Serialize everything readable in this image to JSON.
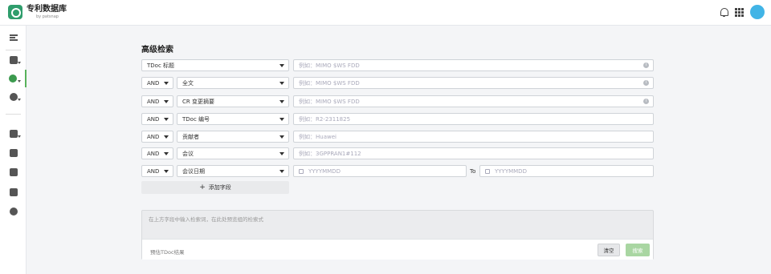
{
  "header": {
    "app_title": "专利数据库",
    "app_subtitle": "by patsnap"
  },
  "page": {
    "title": "高级检索"
  },
  "operator_label": "AND",
  "rows": [
    {
      "field": "TDoc 标题",
      "placeholder": "例如：MIMO $WS FDD",
      "info": "i"
    },
    {
      "field": "全文",
      "placeholder": "例如：MIMO $WS FDD",
      "info": "i"
    },
    {
      "field": "CR 变更摘要",
      "placeholder": "例如：MIMO $WS FDD",
      "info": "i"
    },
    {
      "field": "TDoc 编号",
      "placeholder": "例如：R2-2311825"
    },
    {
      "field": "贡献者",
      "placeholder": "例如：Huawei"
    },
    {
      "field": "会议",
      "placeholder": "例如：3GPPRAN1#112"
    },
    {
      "field": "会议日期",
      "from_placeholder": "YYYYMMDD",
      "to_label": "To",
      "to_placeholder": "YYYYMMDD"
    }
  ],
  "add_field_label": "添加字段",
  "query_panel": {
    "hint": "在上方字段中输入检索词，在此处预览组的检索式",
    "status": "预估TDoc结果",
    "clear_label": "清空",
    "search_label": "搜索"
  },
  "colors": {
    "accent": "#58b25b",
    "search_disabled": "#a9d6a2",
    "avatar": "#41b4e6"
  }
}
